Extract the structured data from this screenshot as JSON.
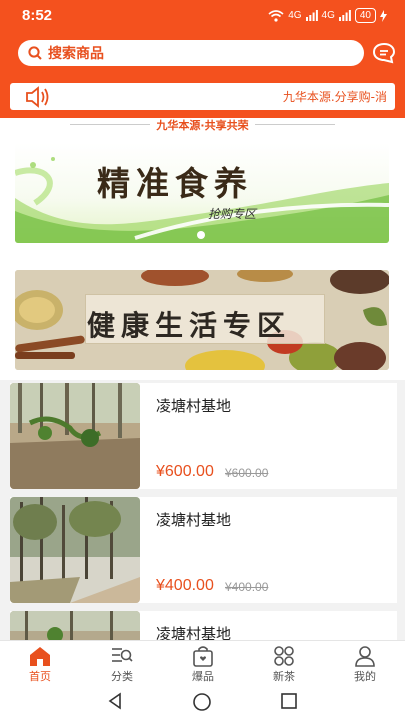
{
  "status": {
    "time": "8:52",
    "net1": "4G",
    "net2": "4G",
    "battery": "40"
  },
  "colors": {
    "accent": "#f4511e",
    "price": "#e8501e"
  },
  "search": {
    "placeholder": "搜索商品",
    "icon": "search-icon",
    "message_icon": "message-icon"
  },
  "notice": {
    "icon": "speaker-icon",
    "text": "九华本源.分享购-消"
  },
  "section_divider": {
    "label": "九华本源·共享共荣"
  },
  "banners": [
    {
      "title": "精准食养",
      "subtitle": "抢购专区"
    },
    {
      "title": "健康生活专区"
    }
  ],
  "products": [
    {
      "name": "凌塘村基地",
      "price": "¥600.00",
      "original_price": "¥600.00"
    },
    {
      "name": "凌塘村基地",
      "price": "¥400.00",
      "original_price": "¥400.00"
    },
    {
      "name": "凌塘村基地"
    }
  ],
  "tabs": [
    {
      "label": "首页",
      "icon": "home-icon",
      "active": true
    },
    {
      "label": "分类",
      "icon": "category-icon"
    },
    {
      "label": "爆品",
      "icon": "bag-icon"
    },
    {
      "label": "新茶",
      "icon": "grid-icon"
    },
    {
      "label": "我的",
      "icon": "user-icon"
    }
  ],
  "system_nav": [
    "back-icon",
    "home-circle-icon",
    "recents-icon"
  ]
}
